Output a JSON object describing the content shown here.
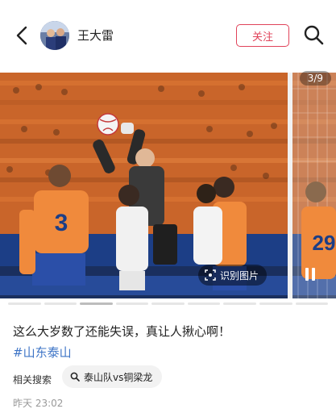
{
  "header": {
    "username": "王大雷",
    "follow_label": "关注",
    "icons": {
      "back": "chevron-left-icon",
      "search": "search-icon"
    }
  },
  "photo": {
    "page_indicator": "3/9",
    "identify_label": "识别图片",
    "player_numbers": [
      "3",
      "29"
    ],
    "progress_segments": 9,
    "current_segment": 3
  },
  "post": {
    "caption": "这么大岁数了还能失误，真让人揪心啊！",
    "hashtag": "#山东泰山",
    "related_label": "相关搜索",
    "related_query": "泰山队vs铜梁龙",
    "timestamp": "昨天 23:02"
  },
  "colors": {
    "accent_red": "#e0435a",
    "hashtag_blue": "#3d74c6",
    "team_orange": "#f08a3c"
  }
}
